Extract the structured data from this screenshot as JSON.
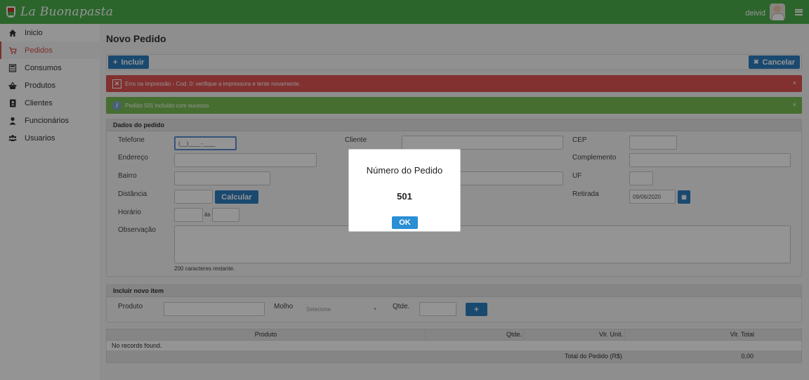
{
  "app": {
    "brand": "La Buonapasta",
    "username": "deivid"
  },
  "sidebar": {
    "items": [
      {
        "label": "Inicio",
        "icon": "home-icon"
      },
      {
        "label": "Pedidos",
        "icon": "cart-icon"
      },
      {
        "label": "Consumos",
        "icon": "calculator-icon"
      },
      {
        "label": "Produtos",
        "icon": "basket-icon"
      },
      {
        "label": "Clientes",
        "icon": "address-book-icon"
      },
      {
        "label": "Funcionários",
        "icon": "user-icon"
      },
      {
        "label": "Usuarios",
        "icon": "users-icon"
      }
    ],
    "active_index": 1
  },
  "page": {
    "title": "Novo Pedido",
    "toolbar": {
      "include_label": "Incluir",
      "cancel_label": "Cancelar"
    },
    "messages": {
      "error": "Erro na impressão - Cod. 0: verifique a impressora e tente novamente.",
      "success": "Pedido 501 incluído com sucesso"
    }
  },
  "order_form": {
    "heading": "Dados do pedido",
    "labels": {
      "phone": "Telefone",
      "address": "Endereço",
      "district": "Bairro",
      "distance": "Distância",
      "time": "Horário",
      "note": "Observação",
      "client": "Cliente",
      "cep": "CEP",
      "complement": "Complemento",
      "uf": "UF",
      "pickup": "Retirada"
    },
    "phone_mask": "(__)____-____",
    "calculate_label": "Calcular",
    "time_sep": "às",
    "pickup_date": "09/06/2020",
    "chars_remaining": "200 caracteres restante."
  },
  "item_form": {
    "heading": "Incluir novo item",
    "product_label": "Produto",
    "sauce_label": "Molho",
    "sauce_placeholder": "Selecione",
    "qty_label": "Qtde.",
    "add_label": "+"
  },
  "items_table": {
    "columns": [
      "Produto",
      "Qtde.",
      "Vlr. Unit.",
      "Vlr. Total"
    ],
    "empty_text": "No records found.",
    "total_label": "Total do Pedido (R$)",
    "total_value": "0,00"
  },
  "dialog": {
    "title": "Número do Pedido",
    "number": "501",
    "ok_label": "OK"
  },
  "colors": {
    "topbar": "#4cae4c",
    "primary": "#2e7fc1",
    "error": "#e05353",
    "success": "#7bbd55",
    "active_nav": "#d9534f"
  }
}
